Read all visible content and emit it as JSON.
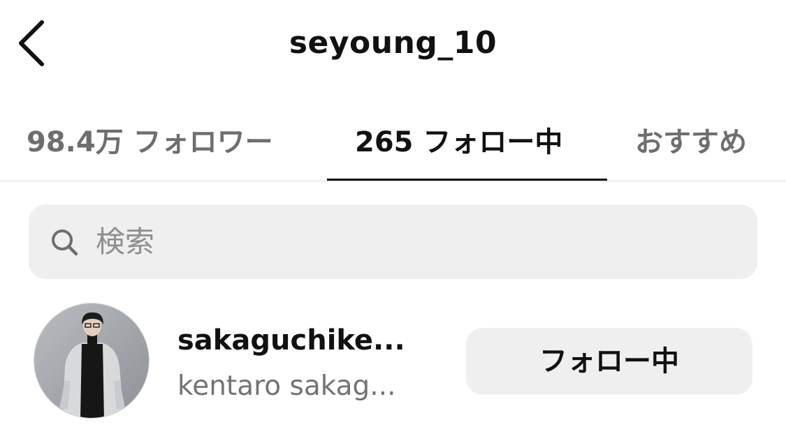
{
  "header": {
    "title": "seyoung_10",
    "back_icon": "chevron-left-icon"
  },
  "tabs": [
    {
      "label": "98.4万 フォロワー",
      "active": false
    },
    {
      "label": "265 フォロー中",
      "active": true
    },
    {
      "label": "おすすめ",
      "active": false
    }
  ],
  "search": {
    "placeholder": "検索",
    "icon": "search-icon"
  },
  "users": [
    {
      "username": "sakaguchike...",
      "full_name": "kentaro sakag...",
      "button_label": "フォロー中"
    }
  ],
  "colors": {
    "text_primary": "#111111",
    "text_secondary": "#737373",
    "tab_inactive": "#6e6e6e",
    "surface": "#efeff0",
    "divider": "#dbdbdb"
  }
}
